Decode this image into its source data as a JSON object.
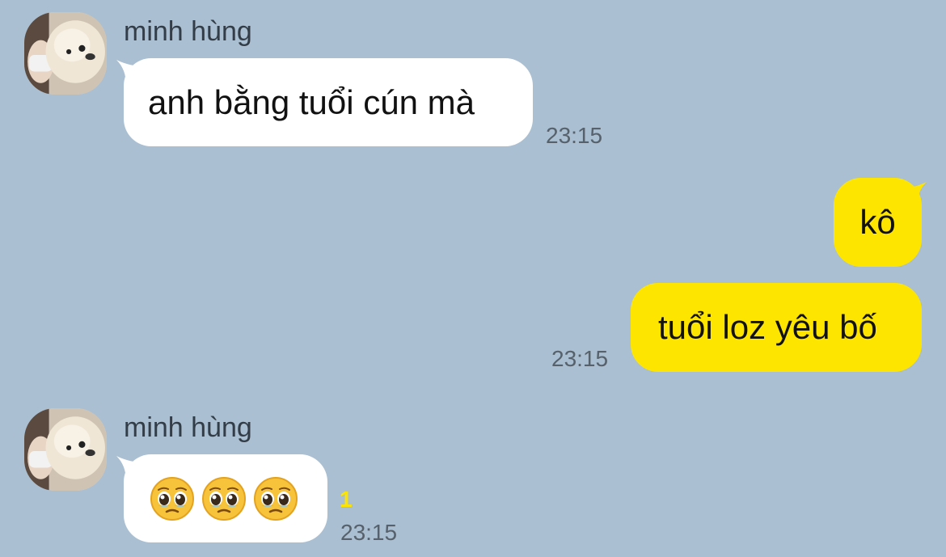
{
  "messages": [
    {
      "direction": "incoming",
      "sender": "minh hùng",
      "text": "anh bằng tuổi cún mà",
      "time": "23:15"
    },
    {
      "direction": "outgoing",
      "text": "kô"
    },
    {
      "direction": "outgoing",
      "text": "tuổi loz yêu bố",
      "time": "23:15"
    },
    {
      "direction": "incoming",
      "sender": "minh hùng",
      "emojis": [
        "pleading-face-emoji",
        "pleading-face-emoji",
        "pleading-face-emoji"
      ],
      "unread_count": "1",
      "time": "23:15"
    }
  ],
  "colors": {
    "background": "#aabfd1",
    "incoming_bubble": "#ffffff",
    "outgoing_bubble": "#fee500",
    "unread": "#fee500",
    "time": "#56616b"
  }
}
